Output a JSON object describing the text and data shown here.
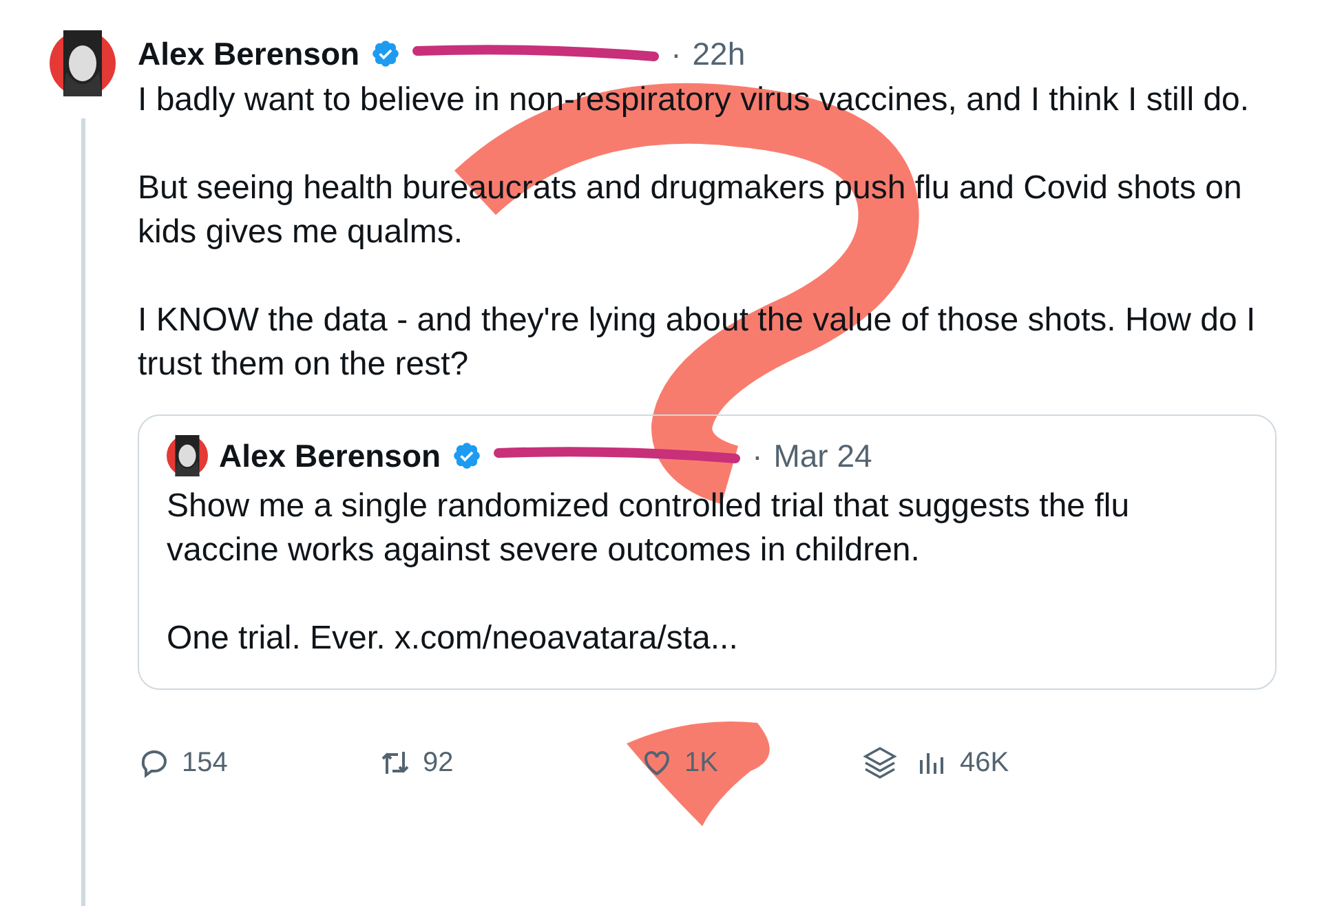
{
  "post": {
    "author": "Alex Berenson",
    "verified": true,
    "separator": "·",
    "time": "22h",
    "paragraphs": [
      "I badly want to believe in non-respiratory virus vaccines, and I think I still do.",
      "But seeing health bureaucrats and drugmakers push flu and Covid shots on kids gives me qualms.",
      "I KNOW the data - and they're lying about the value of those shots. How do I trust them on the rest?"
    ],
    "quote": {
      "author": "Alex Berenson",
      "verified": true,
      "separator": "·",
      "time": "Mar 24",
      "paragraphs": [
        "Show me a single randomized controlled trial that suggests the flu vaccine works against severe outcomes in children.",
        "One trial. Ever. x.com/neoavatara/sta..."
      ]
    },
    "actions": [
      {
        "kind": "reply",
        "count": "154"
      },
      {
        "kind": "repost",
        "count": "92"
      },
      {
        "kind": "like",
        "count": "1K"
      },
      {
        "kind": "views",
        "count": "46K"
      }
    ]
  }
}
